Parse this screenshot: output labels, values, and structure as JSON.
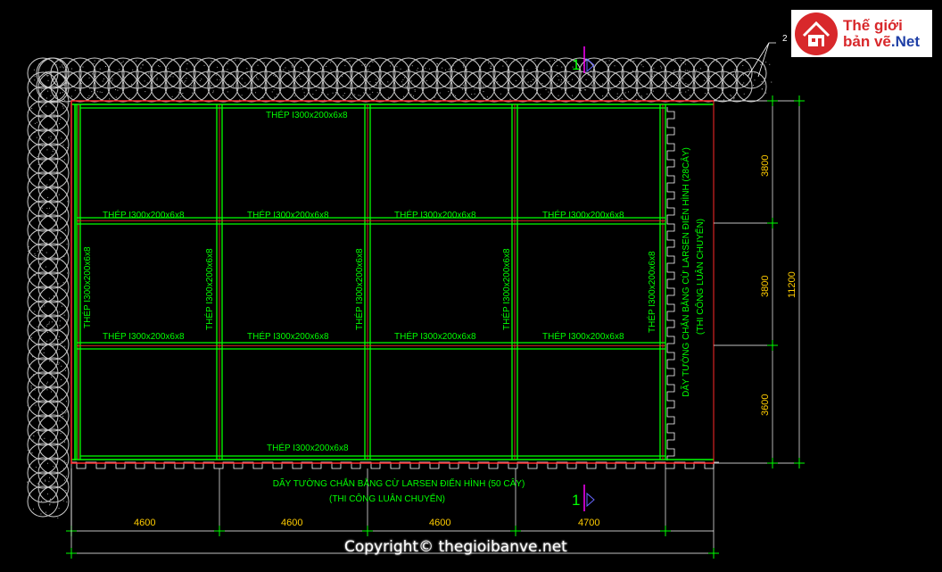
{
  "logo": {
    "line1": "Thế giới",
    "line2": "bản vẽ",
    "line3": ".Net"
  },
  "copyright": "Copyright© thegioibanve.net",
  "beam_label": "THÉP I300x200x6x8",
  "wall_bottom": {
    "line1": "DÃY TƯỜNG CHẮN BẰNG CỪ LARSEN ĐIỂN HÌNH (50 CÂY)",
    "line2": "(THI CÔNG LUÂN CHUYỂN)"
  },
  "wall_right": {
    "line1": "DÃY TƯỜNG CHẮN BẰNG CỪ LARSEN ĐIỂN HÌNH (28CÂY)",
    "line2": "(THI CÔNG LUÂN CHUYỂN)"
  },
  "section_mark": "1",
  "callout": "2",
  "dims_horizontal": [
    "4600",
    "4600",
    "4600",
    "4700"
  ],
  "dims_vertical": [
    "3800",
    "3800",
    "3600"
  ],
  "dim_total": "11200",
  "colors": {
    "beam": "#00ff00",
    "edge": "#ff2a2a",
    "dim_text": "#ffcc00",
    "dim_line": "#ffffff",
    "mark": "#ff00ff",
    "section": "#5555ff"
  }
}
